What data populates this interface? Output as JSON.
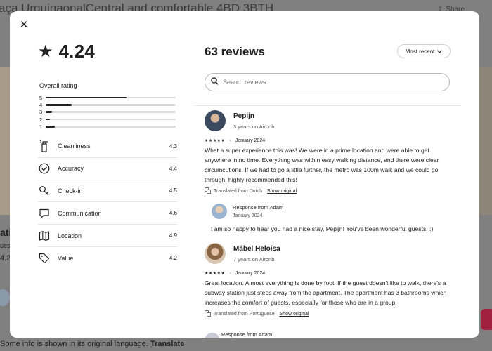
{
  "background": {
    "listing_title": "aça UrquinaonalCentral and comfortable 4BD 3BTH",
    "share_label": "Share",
    "frag_1": "atin",
    "frag_2": "ues",
    "frag_3": "4.2",
    "footer_text": "Some info is shown in its original language.",
    "footer_link": "Translate"
  },
  "modal": {
    "close_icon": "close-icon",
    "overall": {
      "score": "4.24",
      "label": "Overall rating",
      "distribution": [
        {
          "stars": "5",
          "fraction": 0.62
        },
        {
          "stars": "4",
          "fraction": 0.2
        },
        {
          "stars": "3",
          "fraction": 0.05
        },
        {
          "stars": "2",
          "fraction": 0.03
        },
        {
          "stars": "1",
          "fraction": 0.07
        }
      ]
    },
    "categories": [
      {
        "name": "Cleanliness",
        "value": "4.3",
        "icon": "spray-bottle-icon"
      },
      {
        "name": "Accuracy",
        "value": "4.4",
        "icon": "check-circle-icon"
      },
      {
        "name": "Check-in",
        "value": "4.5",
        "icon": "key-icon"
      },
      {
        "name": "Communication",
        "value": "4.6",
        "icon": "message-icon"
      },
      {
        "name": "Location",
        "value": "4.9",
        "icon": "map-icon"
      },
      {
        "name": "Value",
        "value": "4.2",
        "icon": "tag-icon"
      }
    ],
    "reviews_title": "63 reviews",
    "sort_label": "Most recent",
    "search": {
      "placeholder": "Search reviews"
    },
    "reviews": [
      {
        "name": "Pepijn",
        "tenure": "3 years on Airbnb",
        "stars": "★★★★★",
        "date": "January 2024",
        "text": "What a super experience this was! We were in a prime location and were able to get anywhere in no time. Everything was within easy walking distance, and there were clear circumcutions. If we had to go a little further, the metro was 100m walk and we could go through, highly recommended this!",
        "translated": "Translated from Dutch",
        "show_original": "Show original",
        "response": {
          "from": "Response from Adam",
          "date": "January 2024",
          "text": "I am so happy to hear you had a nice stay, Pepijn! You've been wonderful guests! :)"
        },
        "avatar_color": "#3b4a5e"
      },
      {
        "name": "Mábel Heloísa",
        "tenure": "7 years on Airbnb",
        "stars": "★★★★★",
        "date": "January 2024",
        "text": "Great location. Almost everything is done by foot. If the guest doesn't like to walk, there's a subway station just steps away from the apartment. The apartment has 3 bathrooms which increases the comfort of guests, especially for those who are in a group.",
        "translated": "Translated from Portuguese",
        "show_original": "Show original",
        "avatar_color": "#b08a63"
      }
    ],
    "next_response_peek": "Response from Adam"
  }
}
